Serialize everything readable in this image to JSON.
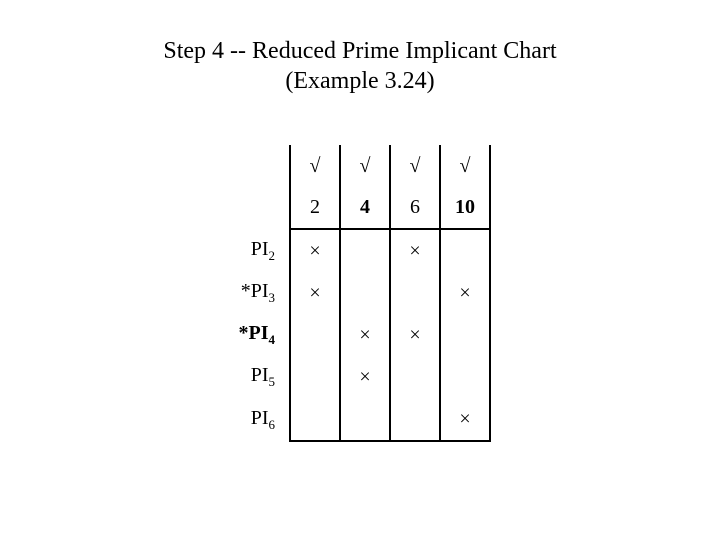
{
  "title_line1": "Step 4 -- Reduced Prime Implicant Chart",
  "title_line2": "(Example 3.24)",
  "checkmark": "√",
  "crossmark": "×",
  "columns": [
    "2",
    "4",
    "6",
    "10"
  ],
  "bold_columns": [
    false,
    true,
    false,
    true
  ],
  "rows": [
    {
      "star": false,
      "label_base": "PI",
      "label_sub": "2",
      "bold": false,
      "marks": [
        true,
        false,
        true,
        false
      ]
    },
    {
      "star": true,
      "label_base": "PI",
      "label_sub": "3",
      "bold": false,
      "marks": [
        true,
        false,
        false,
        true
      ]
    },
    {
      "star": true,
      "label_base": "PI",
      "label_sub": "4",
      "bold": true,
      "marks": [
        false,
        true,
        true,
        false
      ]
    },
    {
      "star": false,
      "label_base": "PI",
      "label_sub": "5",
      "bold": false,
      "marks": [
        false,
        true,
        false,
        false
      ]
    },
    {
      "star": false,
      "label_base": "PI",
      "label_sub": "6",
      "bold": false,
      "marks": [
        false,
        false,
        false,
        true
      ]
    }
  ],
  "chart_data": {
    "type": "table",
    "title": "Step 4 -- Reduced Prime Implicant Chart (Example 3.24)",
    "column_headers": [
      "2",
      "4",
      "6",
      "10"
    ],
    "column_checks": [
      true,
      true,
      true,
      true
    ],
    "row_headers": [
      "PI2",
      "*PI3",
      "*PI4",
      "PI5",
      "PI6"
    ],
    "essential_rows": [
      "*PI3",
      "*PI4"
    ],
    "grid": [
      [
        1,
        0,
        1,
        0
      ],
      [
        1,
        0,
        0,
        1
      ],
      [
        0,
        1,
        1,
        0
      ],
      [
        0,
        1,
        0,
        0
      ],
      [
        0,
        0,
        0,
        1
      ]
    ]
  }
}
